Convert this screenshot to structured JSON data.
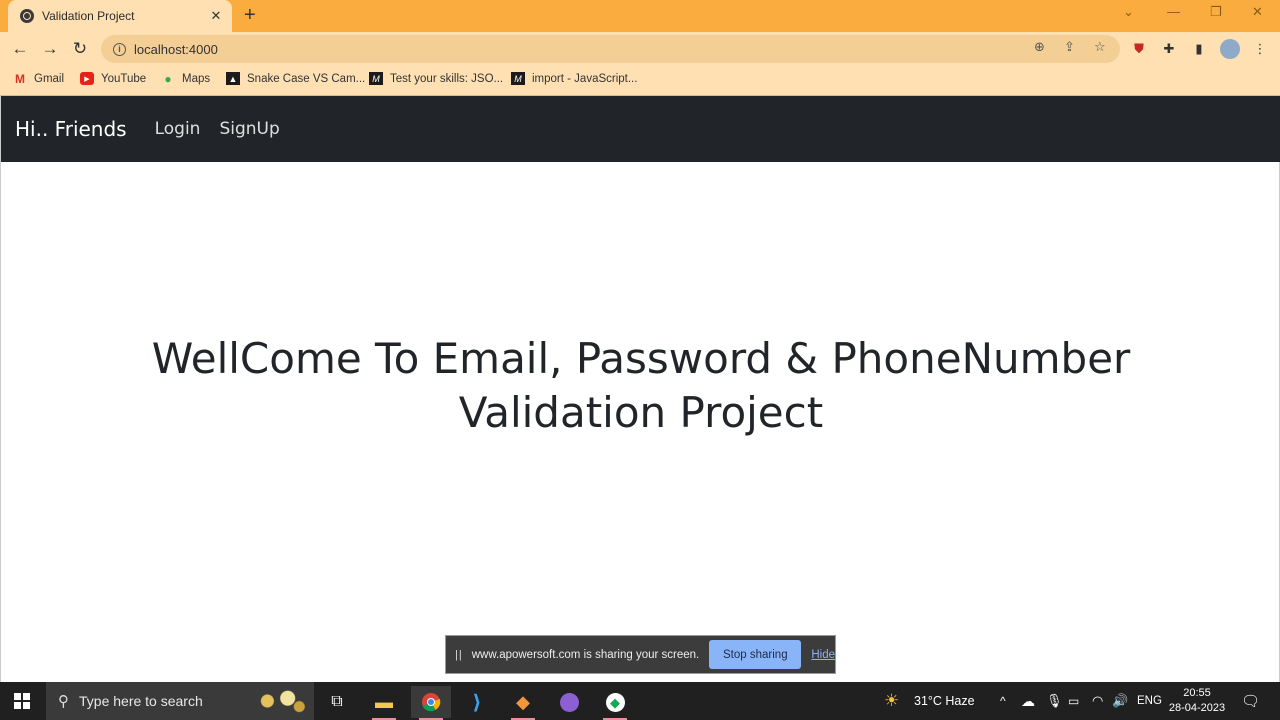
{
  "browser": {
    "tab_title": "Validation Project",
    "tab_close": "✕",
    "new_tab": "+",
    "url": "localhost:4000",
    "bookmarks": [
      {
        "label": "Gmail"
      },
      {
        "label": "YouTube"
      },
      {
        "label": "Maps"
      },
      {
        "label": "Snake Case VS Cam..."
      },
      {
        "label": "Test your skills: JSO..."
      },
      {
        "label": "import - JavaScript..."
      }
    ]
  },
  "page": {
    "brand": "Hi.. Friends",
    "nav_links": [
      "Login",
      "SignUp"
    ],
    "hero_line1": "WellCome To Email, Password & PhoneNumber",
    "hero_line2": "Validation Project"
  },
  "share_bar": {
    "message": "www.apowersoft.com is sharing your screen.",
    "stop_label": "Stop sharing",
    "hide_label": "Hide"
  },
  "taskbar": {
    "search_placeholder": "Type here to search",
    "weather": "31°C  Haze",
    "language": "ENG",
    "time": "20:55",
    "date": "28-04-2023"
  }
}
